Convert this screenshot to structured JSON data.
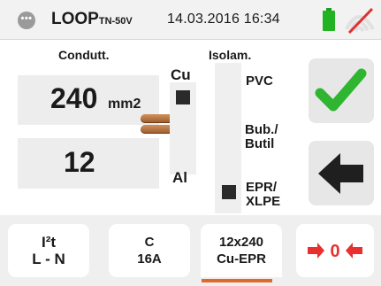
{
  "header": {
    "menu_icon_text": "•••",
    "title": "LOOP",
    "title_sub": "TN-50V",
    "datetime": "14.03.2016 16:34"
  },
  "conductor": {
    "label": "Condutt.",
    "section_value": "240",
    "section_unit": "mm2",
    "count_value": "12"
  },
  "material": {
    "top_label": "Cu",
    "bottom_label": "Al",
    "selected": "Cu"
  },
  "insulation": {
    "label": "Isolam.",
    "options": [
      "PVC",
      "Bub./ Butil",
      "EPR/ XLPE"
    ],
    "opt_pvc": "PVC",
    "opt_bub": "Bub./",
    "opt_butil": "Butil",
    "opt_epr": "EPR/",
    "opt_xlpe": "XLPE",
    "selected": "EPR/XLPE"
  },
  "buttons": {
    "i2t_line1": "I²t",
    "i2t_line2": "L - N",
    "c_line1": "C",
    "c_line2": "16A",
    "cable_line1": "12x240",
    "cable_line2": "Cu-EPR",
    "zero_text": "0"
  },
  "colors": {
    "accent": "#e2682a",
    "ok_green": "#2fb52f",
    "battery_green": "#22b322",
    "no_signal_red": "#e03030",
    "arrow_red": "#e83030"
  },
  "icons": {
    "menu": "menu-dots-icon",
    "battery": "battery-icon",
    "wifi": "wifi-off-icon",
    "ok": "check-icon",
    "back": "back-arrow-icon",
    "conductor": "cable-icon",
    "zero": "zero-arrows-icon"
  }
}
